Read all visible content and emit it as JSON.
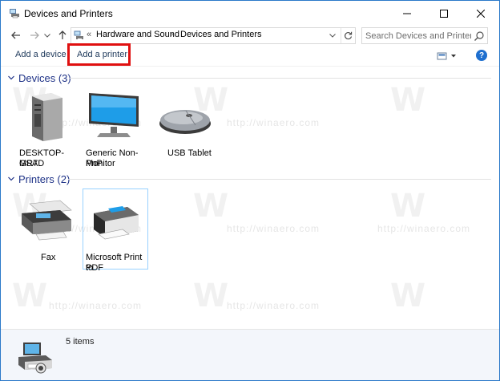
{
  "window": {
    "title": "Devices and Printers",
    "icon": "devices-printers-icon"
  },
  "address": {
    "overflow": "«",
    "crumbs": [
      "Hardware and Sound",
      "Devices and Printers"
    ],
    "separator": "›"
  },
  "search": {
    "placeholder": "Search Devices and Printers"
  },
  "commands": {
    "add_device": "Add a device",
    "add_printer": "Add a printer",
    "help": "?"
  },
  "groups": {
    "devices": {
      "label": "Devices (3)",
      "items": [
        {
          "label_line1": "DESKTOP-GSAD",
          "label_line2": "MR7",
          "icon": "computer-tower-icon"
        },
        {
          "label_line1": "Generic Non-PnP",
          "label_line2": "Monitor",
          "icon": "monitor-icon"
        },
        {
          "label_line1": "USB Tablet",
          "label_line2": "",
          "icon": "mouse-icon"
        }
      ]
    },
    "printers": {
      "label": "Printers (2)",
      "items": [
        {
          "label_line1": "Fax",
          "label_line2": "",
          "icon": "fax-icon"
        },
        {
          "label_line1": "Microsoft Print to",
          "label_line2": "PDF",
          "icon": "printer-icon"
        }
      ]
    }
  },
  "status": {
    "count": "5 items"
  },
  "watermark": {
    "text": "http://winaero.com",
    "letter": "W"
  },
  "colors": {
    "accent": "#2b79c9",
    "group_header": "#1e3287",
    "highlight": "#e01010",
    "selection": "#99d1ff"
  }
}
